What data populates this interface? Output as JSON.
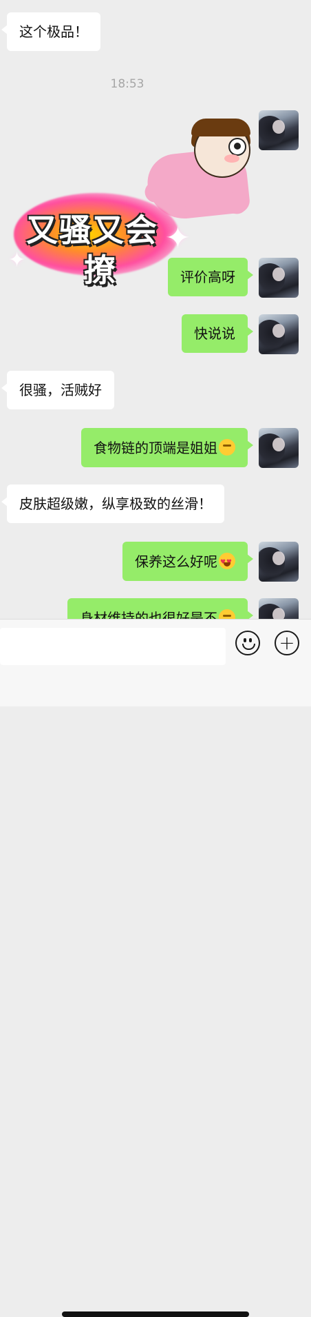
{
  "chat": {
    "timestamp": "18:53",
    "messages": [
      {
        "side": "in",
        "text": "这个极品！"
      },
      {
        "side": "out",
        "type": "sticker",
        "sticker_text_1": "又骚又会",
        "sticker_text_2": "撩"
      },
      {
        "side": "out",
        "text": "评价高呀"
      },
      {
        "side": "out",
        "text": "快说说"
      },
      {
        "side": "in",
        "text": "很骚，活贼好"
      },
      {
        "side": "out",
        "text": "食物链的顶端是姐姐",
        "emoji": "thinking-face"
      },
      {
        "side": "in",
        "text": "皮肤超级嫩，纵享极致的丝滑！"
      },
      {
        "side": "out",
        "text": "保养这么好呢",
        "emoji": "heart-eyes-face"
      },
      {
        "side": "out",
        "text": "身材维持的也很好是不",
        "emoji": "thinking-face"
      }
    ]
  },
  "input_bar": {
    "icons": [
      "smiley-icon",
      "plus-icon"
    ],
    "plus_symbol": "+"
  },
  "colors": {
    "background": "#ededed",
    "incoming_bubble": "#ffffff",
    "outgoing_bubble": "#95ec69"
  }
}
